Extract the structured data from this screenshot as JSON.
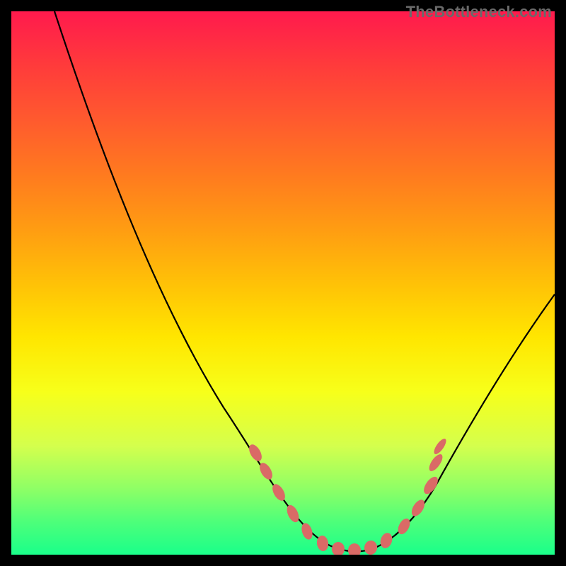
{
  "watermark": "TheBottleneck.com",
  "colors": {
    "curve_stroke": "#000000",
    "marker_fill": "#da6a66",
    "background": "#000000"
  },
  "chart_data": {
    "type": "line",
    "title": "",
    "xlabel": "",
    "ylabel": "",
    "xlim": [
      0,
      100
    ],
    "ylim": [
      0,
      100
    ],
    "grid": false,
    "series": [
      {
        "name": "bottleneck-curve",
        "x": [
          8,
          12,
          16,
          20,
          24,
          28,
          32,
          36,
          40,
          44,
          48,
          52,
          56,
          60,
          64,
          68,
          72,
          76,
          80,
          84,
          88,
          92,
          96,
          100
        ],
        "y": [
          100,
          92,
          84,
          76,
          68,
          60,
          52,
          44,
          36,
          28,
          20,
          12,
          6,
          3,
          2,
          3,
          6,
          11,
          17,
          23,
          29,
          35,
          41,
          47
        ]
      }
    ],
    "markers": {
      "name": "highlighted-points",
      "x": [
        46,
        48,
        50,
        54,
        58,
        60,
        62,
        64,
        66,
        68,
        72,
        74,
        76
      ],
      "y": [
        17,
        13,
        10,
        6,
        3,
        3,
        2,
        2,
        3,
        3,
        6,
        8,
        11
      ]
    }
  }
}
